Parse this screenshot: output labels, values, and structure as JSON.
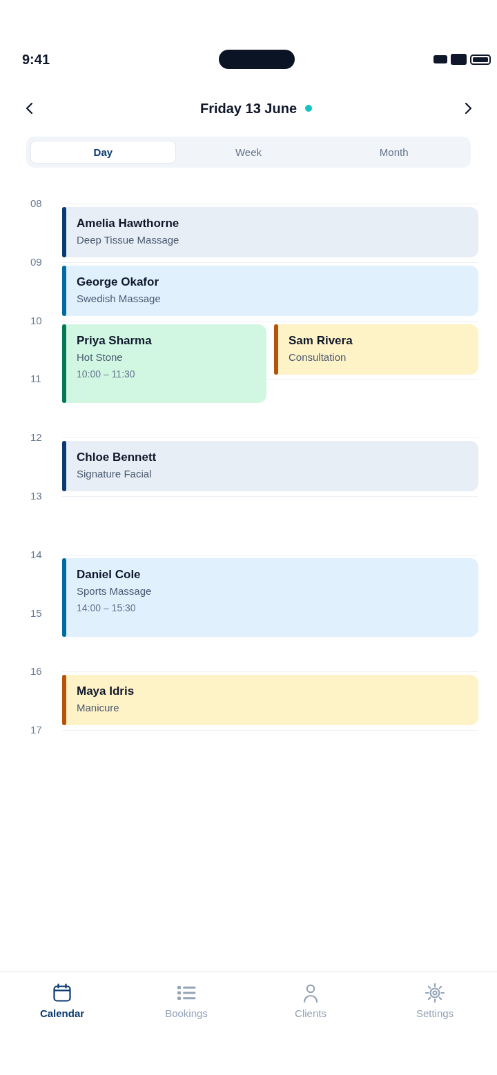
{
  "status_bar": {
    "time": "9:41"
  },
  "header": {
    "title": "Friday 13 June"
  },
  "view_tabs": [
    {
      "label": "Day",
      "selected": true
    },
    {
      "label": "Week",
      "selected": false
    },
    {
      "label": "Month",
      "selected": false
    }
  ],
  "hours": [
    {
      "label": "08",
      "appointments": [
        {
          "client": "Amelia Hawthorne",
          "service": "Deep Tissue Massage",
          "color": "#0b3a6e",
          "kind": "hour"
        }
      ]
    },
    {
      "label": "09",
      "appointments": [
        {
          "client": "George Okafor",
          "service": "Swedish Massage",
          "color": "#0369a1",
          "kind": "hour"
        }
      ]
    },
    {
      "label": "10",
      "appointments": [
        {
          "client": "Priya Sharma",
          "service": "Hot Stone",
          "time": "10:00 – 11:30",
          "color": "#047857",
          "kind": "extended"
        },
        {
          "client": "Sam Rivera",
          "service": "Consultation",
          "color": "#b45309",
          "kind": "hour"
        }
      ]
    },
    {
      "label": "11"
    },
    {
      "label": "12",
      "appointments": [
        {
          "client": "Chloe Bennett",
          "service": "Signature Facial",
          "color": "#0b3a6e",
          "kind": "hour"
        }
      ]
    },
    {
      "label": "13"
    },
    {
      "label": "14",
      "appointments": [
        {
          "client": "Daniel Cole",
          "service": "Sports Massage",
          "time": "14:00 – 15:30",
          "color": "#0369a1",
          "kind": "extended"
        }
      ]
    },
    {
      "label": "15"
    },
    {
      "label": "16",
      "appointments": [
        {
          "client": "Maya Idris",
          "service": "Manicure",
          "color": "#b45309",
          "kind": "hour"
        }
      ]
    },
    {
      "label": "17"
    }
  ],
  "tab_bar": [
    {
      "label": "Calendar",
      "selected": true
    },
    {
      "label": "Bookings",
      "selected": false
    },
    {
      "label": "Clients",
      "selected": false
    },
    {
      "label": "Settings",
      "selected": false
    }
  ]
}
